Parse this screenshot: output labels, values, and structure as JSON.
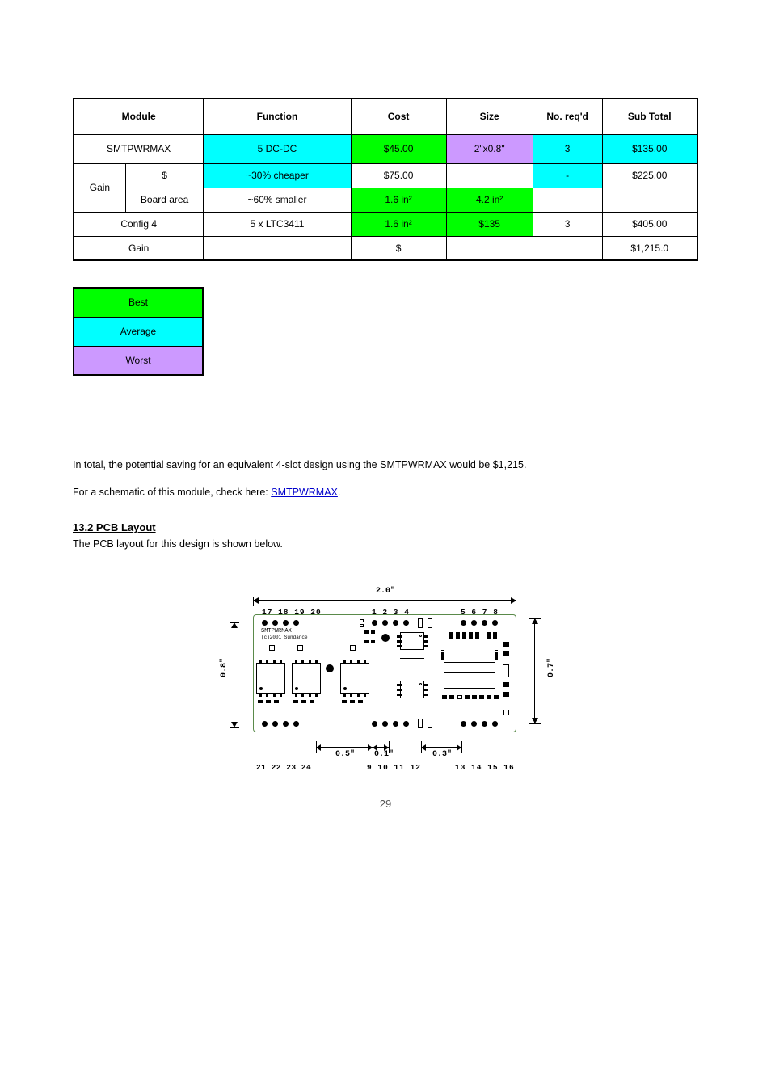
{
  "table": {
    "headers": [
      "Module",
      "Function",
      "Cost",
      "Size",
      "No. req'd",
      "Sub Total"
    ],
    "rows": [
      {
        "cells": [
          "SMTPWRMAX",
          "5 DC-DC",
          "$45.00",
          "2\"x0.8\"",
          "3",
          "$135.00"
        ],
        "bg": [
          "",
          "cyan",
          "green",
          "violet",
          "cyan",
          "cyan"
        ]
      },
      {
        "rowspanLabel": "Gain",
        "cells": [
          "$",
          "~30% cheaper",
          "$75.00",
          "",
          "-",
          "$225.00"
        ],
        "bg": [
          "",
          "cyan",
          "",
          "",
          "cyan",
          ""
        ]
      },
      {
        "cells": [
          "Board area",
          "~60% smaller",
          "1.6 in²",
          "4.2 in²",
          "",
          ""
        ],
        "bg": [
          "",
          "",
          "green",
          "green",
          "",
          ""
        ]
      },
      {
        "cells": [
          "Config 4",
          "5 x LTC3411",
          "1.6 in²",
          "$135",
          "3",
          "$405.00"
        ],
        "bg": [
          "",
          "",
          "green",
          "green",
          "",
          ""
        ]
      },
      {
        "cells": [
          "Gain",
          "",
          "$",
          "",
          "",
          "$1,215.0"
        ],
        "bg": [
          "",
          "",
          "",
          "",
          "",
          ""
        ]
      }
    ]
  },
  "legend": [
    {
      "label": "Best",
      "bg": "green"
    },
    {
      "label": "Average",
      "bg": "cyan"
    },
    {
      "label": "Worst",
      "bg": "violet"
    }
  ],
  "paragraphs": [
    "In total, the potential saving for an equivalent 4-slot design using the SMTPWRMAX would be $1,215.",
    {
      "text_before": "For a schematic of this module, check here: ",
      "link_text": "SMTPWRMAX",
      "text_after": "."
    }
  ],
  "section": {
    "title": "13.2\tPCB Layout",
    "body": "The PCB layout for this design is shown below."
  },
  "diagram": {
    "dim_top": "2.0\"",
    "dim_left": "0.8\"",
    "dim_right": "0.7\"",
    "dim_b1": "0.5\"",
    "dim_b2": "0.1\"",
    "dim_b3": "0.3\"",
    "pin_labels_top_left": "17 18 19 20",
    "pin_labels_top_mid": "1  2  3  4",
    "pin_labels_top_right": "5  6  7  8",
    "pin_labels_bot_left": "21 22 23 24",
    "pin_labels_bot_mid": "9  10  11  12",
    "pin_labels_bot_right": "13 14 15 16",
    "silk1": "SMTPWRMAX",
    "silk2": "(c)2001 Sundance"
  },
  "page_number": "29"
}
